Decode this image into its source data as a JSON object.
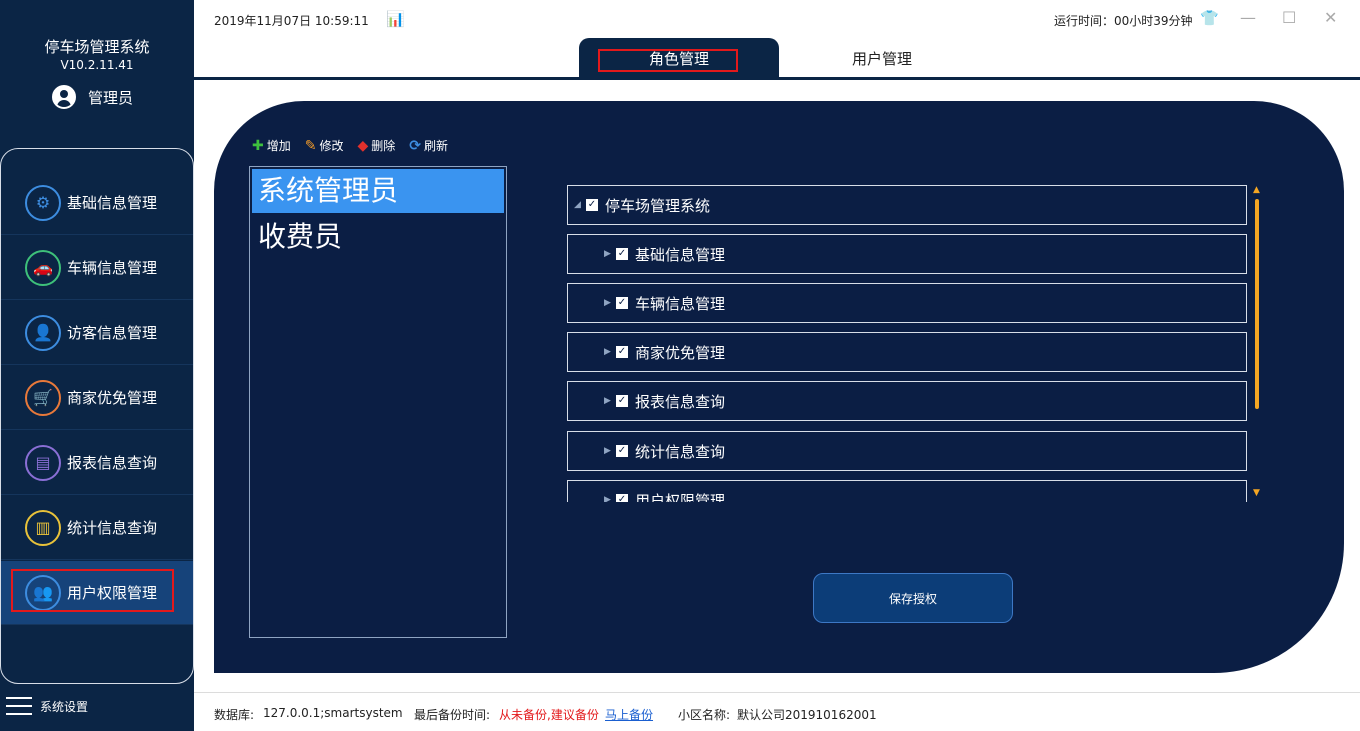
{
  "sidebar": {
    "app_title": "停车场管理系统",
    "version": "V10.2.11.41",
    "user_name": "管理员",
    "items": [
      {
        "label": "基础信息管理",
        "icon": "gear-icon",
        "color": "#3d8de0"
      },
      {
        "label": "车辆信息管理",
        "icon": "car-icon",
        "color": "#3ec17a"
      },
      {
        "label": "访客信息管理",
        "icon": "visitor-icon",
        "color": "#3d8de0"
      },
      {
        "label": "商家优免管理",
        "icon": "cart-icon",
        "color": "#e8793a"
      },
      {
        "label": "报表信息查询",
        "icon": "report-icon",
        "color": "#8a6fd6"
      },
      {
        "label": "统计信息查询",
        "icon": "stats-icon",
        "color": "#e8c23a"
      },
      {
        "label": "用户权限管理",
        "icon": "users-icon",
        "color": "#3d8de0"
      }
    ],
    "settings_label": "系统设置"
  },
  "topbar": {
    "datetime": "2019年11月07日 10:59:11",
    "runtime": "运行时间：00小时39分钟",
    "tabs": [
      {
        "label": "角色管理",
        "active": true
      },
      {
        "label": "用户管理",
        "active": false
      }
    ]
  },
  "toolbar": {
    "add_label": "增加",
    "edit_label": "修改",
    "delete_label": "删除",
    "refresh_label": "刷新"
  },
  "roles": [
    "系统管理员",
    "收费员"
  ],
  "tree": {
    "root": "停车场管理系统",
    "children": [
      "基础信息管理",
      "车辆信息管理",
      "商家优免管理",
      "报表信息查询",
      "统计信息查询",
      "用户权限管理"
    ]
  },
  "save_label": "保存授权",
  "statusbar": {
    "db_label": "数据库:",
    "db_value": "127.0.0.1;smartsystem",
    "backup_label": "最后备份时间:",
    "backup_value": "从未备份,建议备份",
    "backup_link": "马上备份",
    "community_label": "小区名称:",
    "community_value": "默认公司201910162001"
  },
  "colors": {
    "sidebar_bg": "#0b2545",
    "panel_bg": "#0b1e44",
    "highlight": "#e3191b",
    "selected": "#3a94f0",
    "accent": "#f5a623"
  }
}
